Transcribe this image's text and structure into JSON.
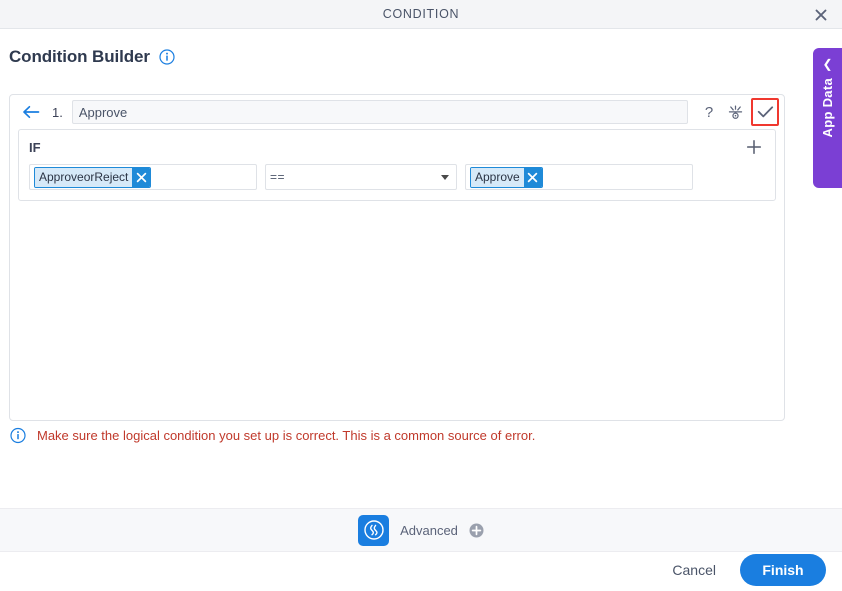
{
  "window": {
    "title": "CONDITION",
    "close_icon": "close-icon"
  },
  "header": {
    "title": "Condition Builder",
    "info_icon": "info-icon"
  },
  "rule": {
    "back_icon": "back-arrow-icon",
    "index": "1.",
    "name_value": "Approve",
    "name_placeholder": "",
    "icons": {
      "help": "?",
      "help_icon": "help-icon",
      "settings_icon": "settings-icon",
      "confirm_icon": "checkmark-icon"
    }
  },
  "condition": {
    "if_label": "IF",
    "add_icon": "plus-icon",
    "left_token": {
      "label": "ApproveorReject",
      "remove_icon": "remove-token-icon"
    },
    "operator": {
      "value": "==",
      "caret_icon": "chevron-down-icon"
    },
    "right_token": {
      "label": "Approve",
      "remove_icon": "remove-token-icon"
    }
  },
  "warning": {
    "icon": "info-icon",
    "text": "Make sure the logical condition you set up is correct. This is a common source of error."
  },
  "advanced": {
    "logo_icon": "app-logo-icon",
    "label": "Advanced",
    "plus_icon": "plus-circle-icon"
  },
  "footer": {
    "cancel_label": "Cancel",
    "finish_label": "Finish"
  },
  "app_data_tab": {
    "label": "App Data",
    "chevron_icon": "chevron-left-icon"
  },
  "colors": {
    "accent_blue": "#1a7ee0",
    "token_blue": "#1f8ad8",
    "token_fill": "#d6e9f8",
    "warning_red": "#c0392b",
    "highlight_red": "#f0382f",
    "app_data_purple": "#7b3fd4"
  }
}
